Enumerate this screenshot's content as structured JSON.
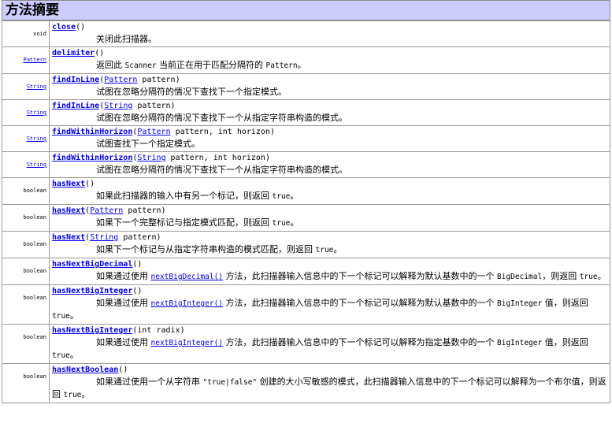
{
  "header": {
    "title": "方法摘要"
  },
  "rows": [
    {
      "type": "void",
      "type_link": false,
      "name": "close",
      "params": [
        {
          "t": "text",
          "v": "()"
        }
      ],
      "desc": [
        {
          "t": "text",
          "v": "关闭此扫描器。"
        }
      ]
    },
    {
      "type": "Pattern",
      "type_link": true,
      "name": "delimiter",
      "params": [
        {
          "t": "text",
          "v": "()"
        }
      ],
      "desc": [
        {
          "t": "text",
          "v": "返回此 "
        },
        {
          "t": "mono",
          "v": "Scanner"
        },
        {
          "t": "text",
          "v": " 当前正在用于匹配分隔符的 "
        },
        {
          "t": "mono",
          "v": "Pattern"
        },
        {
          "t": "text",
          "v": "。"
        }
      ]
    },
    {
      "type": "String",
      "type_link": true,
      "name": "findInLine",
      "params": [
        {
          "t": "text",
          "v": "("
        },
        {
          "t": "link",
          "v": "Pattern"
        },
        {
          "t": "text",
          "v": " pattern)"
        }
      ],
      "desc": [
        {
          "t": "text",
          "v": "试图在忽略分隔符的情况下查找下一个指定模式。"
        }
      ]
    },
    {
      "type": "String",
      "type_link": true,
      "name": "findInLine",
      "params": [
        {
          "t": "text",
          "v": "("
        },
        {
          "t": "link",
          "v": "String"
        },
        {
          "t": "text",
          "v": " pattern)"
        }
      ],
      "desc": [
        {
          "t": "text",
          "v": "试图在忽略分隔符的情况下查找下一个从指定字符串构造的模式。"
        }
      ]
    },
    {
      "type": "String",
      "type_link": true,
      "name": "findWithinHorizon",
      "params": [
        {
          "t": "text",
          "v": "("
        },
        {
          "t": "link",
          "v": "Pattern"
        },
        {
          "t": "text",
          "v": " pattern, int horizon)"
        }
      ],
      "desc": [
        {
          "t": "text",
          "v": "试图查找下一个指定模式。"
        }
      ]
    },
    {
      "type": "String",
      "type_link": true,
      "name": "findWithinHorizon",
      "params": [
        {
          "t": "text",
          "v": "("
        },
        {
          "t": "link",
          "v": "String"
        },
        {
          "t": "text",
          "v": " pattern, int horizon)"
        }
      ],
      "desc": [
        {
          "t": "text",
          "v": "试图在忽略分隔符的情况下查找下一个从指定字符串构造的模式。"
        }
      ]
    },
    {
      "type": "boolean",
      "type_link": false,
      "name": "hasNext",
      "params": [
        {
          "t": "text",
          "v": "()"
        }
      ],
      "desc": [
        {
          "t": "text",
          "v": "如果此扫描器的输入中有另一个标记，则返回 "
        },
        {
          "t": "mono",
          "v": "true"
        },
        {
          "t": "text",
          "v": "。"
        }
      ]
    },
    {
      "type": "boolean",
      "type_link": false,
      "name": "hasNext",
      "params": [
        {
          "t": "text",
          "v": "("
        },
        {
          "t": "link",
          "v": "Pattern"
        },
        {
          "t": "text",
          "v": " pattern)"
        }
      ],
      "desc": [
        {
          "t": "text",
          "v": "如果下一个完整标记与指定模式匹配，则返回 "
        },
        {
          "t": "mono",
          "v": "true"
        },
        {
          "t": "text",
          "v": "。"
        }
      ]
    },
    {
      "type": "boolean",
      "type_link": false,
      "name": "hasNext",
      "params": [
        {
          "t": "text",
          "v": "("
        },
        {
          "t": "link",
          "v": "String"
        },
        {
          "t": "text",
          "v": " pattern)"
        }
      ],
      "desc": [
        {
          "t": "text",
          "v": "如果下一个标记与从指定字符串构造的模式匹配，则返回 "
        },
        {
          "t": "mono",
          "v": "true"
        },
        {
          "t": "text",
          "v": "。"
        }
      ]
    },
    {
      "type": "boolean",
      "type_link": false,
      "name": "hasNextBigDecimal",
      "params": [
        {
          "t": "text",
          "v": "()"
        }
      ],
      "desc": [
        {
          "t": "text",
          "v": "如果通过使用 "
        },
        {
          "t": "mlink",
          "v": "nextBigDecimal()"
        },
        {
          "t": "text",
          "v": " 方法，此扫描器输入信息中的下一个标记可以解释为默认基数中的一个 "
        },
        {
          "t": "mono",
          "v": "BigDecimal"
        },
        {
          "t": "text",
          "v": "，则返回 "
        },
        {
          "t": "mono",
          "v": "true"
        },
        {
          "t": "text",
          "v": "。"
        }
      ]
    },
    {
      "type": "boolean",
      "type_link": false,
      "name": "hasNextBigInteger",
      "params": [
        {
          "t": "text",
          "v": "()"
        }
      ],
      "desc": [
        {
          "t": "text",
          "v": "如果通过使用 "
        },
        {
          "t": "mlink",
          "v": "nextBigInteger()"
        },
        {
          "t": "text",
          "v": " 方法，此扫描器输入信息中的下一个标记可以解释为默认基数中的一个 "
        },
        {
          "t": "mono",
          "v": "BigInteger"
        },
        {
          "t": "text",
          "v": " 值，则返回 "
        },
        {
          "t": "mono",
          "v": "true"
        },
        {
          "t": "text",
          "v": "。"
        }
      ]
    },
    {
      "type": "boolean",
      "type_link": false,
      "name": "hasNextBigInteger",
      "params": [
        {
          "t": "text",
          "v": "(int radix)"
        }
      ],
      "desc": [
        {
          "t": "text",
          "v": "如果通过使用 "
        },
        {
          "t": "mlink",
          "v": "nextBigInteger()"
        },
        {
          "t": "text",
          "v": " 方法，此扫描器输入信息中的下一个标记可以解释为指定基数中的一个 "
        },
        {
          "t": "mono",
          "v": "BigInteger"
        },
        {
          "t": "text",
          "v": " 值，则返回 "
        },
        {
          "t": "mono",
          "v": "true"
        },
        {
          "t": "text",
          "v": "。"
        }
      ]
    },
    {
      "type": "boolean",
      "type_link": false,
      "name": "hasNextBoolean",
      "params": [
        {
          "t": "text",
          "v": "()"
        }
      ],
      "desc": [
        {
          "t": "text",
          "v": "如果通过使用一个从字符串 "
        },
        {
          "t": "mono",
          "v": "\"true|false\""
        },
        {
          "t": "text",
          "v": " 创建的大小写敏感的模式，此扫描器输入信息中的下一个标记可以解释为一个布尔值，则返回 "
        },
        {
          "t": "mono",
          "v": "true"
        },
        {
          "t": "text",
          "v": "。"
        }
      ]
    }
  ]
}
